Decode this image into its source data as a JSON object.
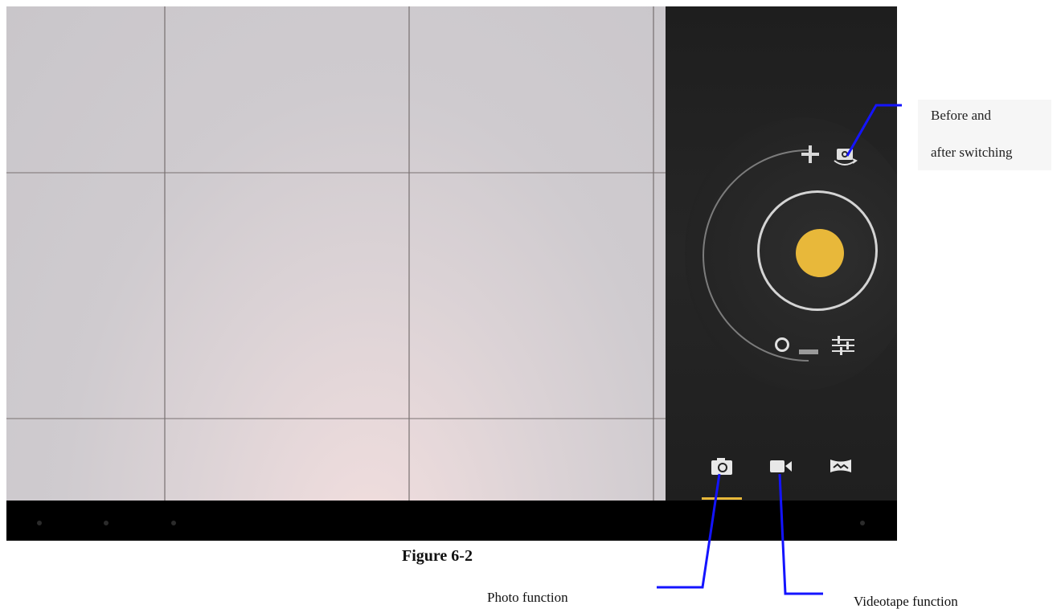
{
  "figure": {
    "caption": "Figure 6-2"
  },
  "annotations": {
    "switch_camera_line1": "Before and",
    "switch_camera_line2": "after switching",
    "photo_function": "Photo function",
    "videotape_function": "Videotape function"
  },
  "camera_ui": {
    "controls": {
      "zoom_in": "plus-icon",
      "zoom_out": "minus-icon",
      "switch_camera": "camera-switch-icon",
      "settings": "sliders-icon",
      "shutter": "shutter-button"
    },
    "modes": [
      {
        "name": "photo",
        "icon": "camera-icon",
        "selected": true
      },
      {
        "name": "video",
        "icon": "video-icon",
        "selected": false
      },
      {
        "name": "panorama",
        "icon": "panorama-icon",
        "selected": false
      }
    ]
  },
  "colors": {
    "accent": "#e8b83a",
    "leader_line": "#1414ff",
    "panel": "#222222"
  }
}
